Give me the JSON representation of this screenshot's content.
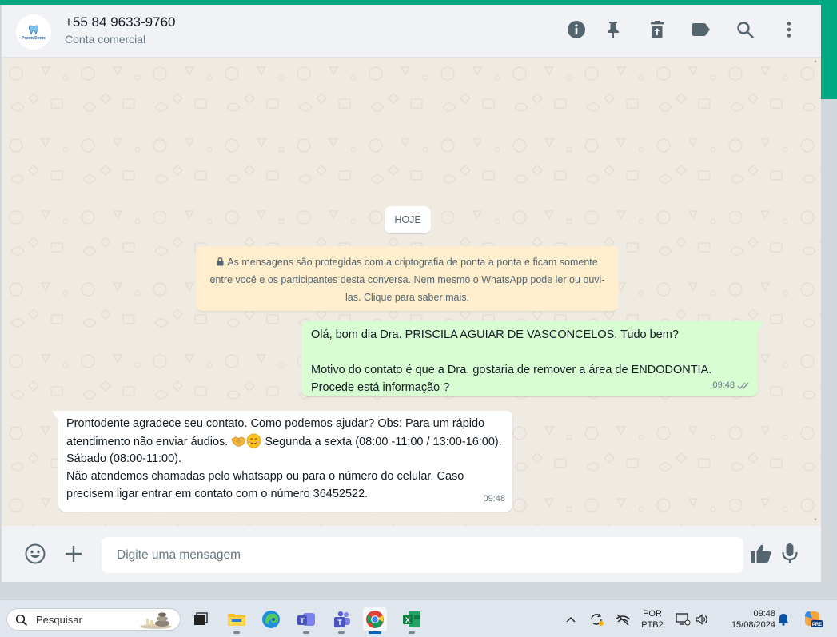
{
  "header": {
    "contact_name": "+55 84 9633-9760",
    "contact_subtitle": "Conta comercial",
    "avatar_brand": "ProntoDente",
    "icons": [
      "info-icon",
      "pin-icon",
      "trash-icon",
      "label-icon",
      "search-icon",
      "menu-icon"
    ]
  },
  "chat": {
    "date_chip": "HOJE",
    "encryption_notice": "As mensagens são protegidas com a criptografia de ponta a ponta e ficam somente entre você e os participantes desta conversa. Nem mesmo o WhatsApp pode ler ou ouvi-las. Clique para saber mais.",
    "outgoing": {
      "text": "Olá, bom dia Dra.  PRISCILA AGUIAR DE VASCONCELOS. Tudo bem?\n\nMotivo do contato é que a Dra. gostaria de remover a área de ENDODONTIA. Procede está informação ?",
      "time": "09:48",
      "status": "read"
    },
    "incoming": {
      "text_part1": "Prontodente agradece seu contato. Como podemos ajudar? Obs: Para um rápido atendimento não enviar áudios.",
      "text_part2": "Segunda a sexta (08:00 -11:00 / 13:00-16:00). Sábado (08:00-11:00).",
      "text_part3": "Não atendemos chamadas pelo whatsapp ou para o número do celular. Caso precisem ligar entrar em contato com o número 36452522.",
      "time": "09:48",
      "emojis": [
        "handshake-emoji",
        "smiling-face-emoji"
      ]
    }
  },
  "composer": {
    "placeholder": "Digite uma mensagem",
    "value": ""
  },
  "taskbar": {
    "search_placeholder": "Pesquisar",
    "apps": [
      "task-view",
      "file-explorer",
      "edge",
      "teams-work",
      "teams",
      "chrome",
      "excel"
    ],
    "active_app": "chrome",
    "language_line1": "POR",
    "language_line2": "PTB2",
    "time": "09:48",
    "date": "15/08/2024"
  },
  "colors": {
    "accent": "#00a884",
    "outgoing_bubble": "#d9fdd3",
    "incoming_bubble": "#ffffff",
    "notice_bg": "#ffeecd",
    "chat_bg": "#efeae2",
    "header_bg": "#f0f2f5"
  }
}
